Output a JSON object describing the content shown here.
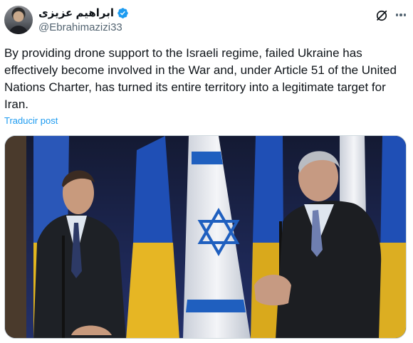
{
  "author": {
    "display_name": "ابراهیم عزیزی",
    "handle": "@Ebrahimazizi33",
    "verified": true,
    "verified_color": "#1d9bf0"
  },
  "header_icons": {
    "grok": "grok-slash-circle-icon",
    "more": "more-dots-icon"
  },
  "tweet": {
    "text": "By providing drone support to the Israeli regime, failed Ukraine has effectively become involved in the War and, under Article 51 of the United Nations Charter, has turned its entire territory into a legitimate target for Iran.",
    "translate_label": "Traducir post"
  },
  "media": {
    "type": "photo"
  },
  "colors": {
    "accent": "#1d9bf0",
    "text": "#0f1419",
    "secondary": "#536471"
  }
}
